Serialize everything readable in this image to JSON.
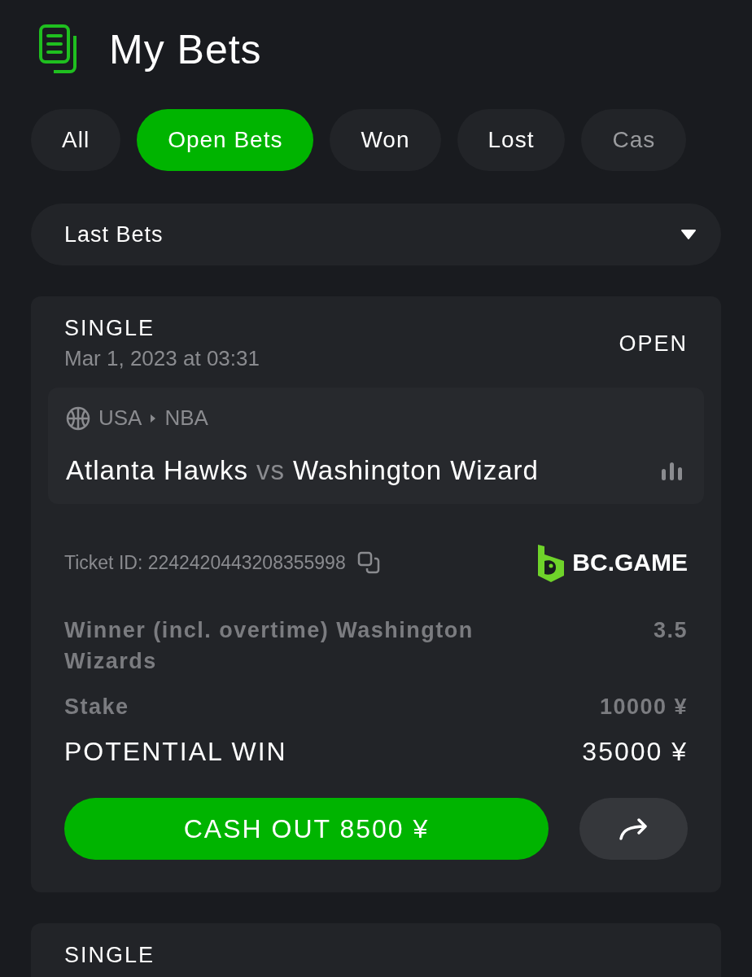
{
  "header": {
    "title": "My Bets"
  },
  "tabs": [
    {
      "label": "All",
      "selected": false
    },
    {
      "label": "Open Bets",
      "selected": true
    },
    {
      "label": "Won",
      "selected": false
    },
    {
      "label": "Lost",
      "selected": false
    },
    {
      "label": "Cas",
      "selected": false
    }
  ],
  "filter": {
    "value": "Last Bets"
  },
  "bets": [
    {
      "type": "SINGLE",
      "date": "Mar 1, 2023 at 03:31",
      "status": "OPEN",
      "country": "USA",
      "league": "NBA",
      "home": "Atlanta Hawks",
      "vs": "vs",
      "away": "Washington Wizard",
      "ticket": "Ticket ID: 2242420443208355998",
      "brand": "BC.GAME",
      "selection": "Winner (incl. overtime) Washington Wizards",
      "odds": "3.5",
      "stake_label": "Stake",
      "stake": "10000 ¥",
      "win_label": "POTENTIAL WIN",
      "win": "35000 ¥",
      "cashout": "CASH OUT 8500 ¥"
    },
    {
      "type": "SINGLE"
    }
  ]
}
